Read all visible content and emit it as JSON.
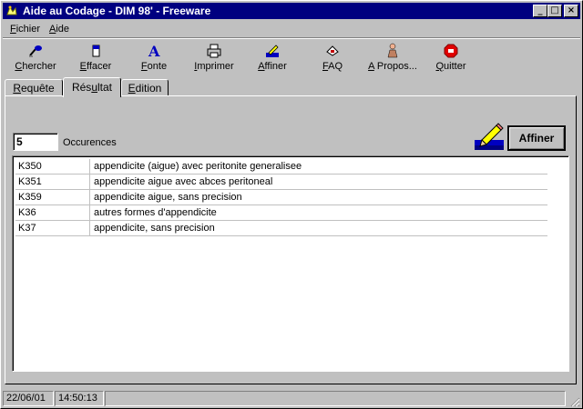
{
  "window": {
    "title": "Aide au Codage - DIM 98' - Freeware",
    "controls": {
      "minimize": "_",
      "maximize": "□",
      "close": "×"
    }
  },
  "menu": [
    {
      "mn": "F",
      "rest": "ichier"
    },
    {
      "mn": "A",
      "rest": "ide"
    }
  ],
  "toolbar": [
    {
      "id": "chercher",
      "icon": "search-icon",
      "mn": "C",
      "rest": "hercher"
    },
    {
      "id": "effacer",
      "icon": "eraser-icon",
      "mn": "E",
      "rest": "ffacer"
    },
    {
      "id": "fonte",
      "icon": "font-icon",
      "mn": "F",
      "rest": "onte"
    },
    {
      "id": "imprimer",
      "icon": "printer-icon",
      "mn": "I",
      "rest": "mprimer"
    },
    {
      "id": "affiner",
      "icon": "pencil-icon",
      "mn": "A",
      "rest": "ffiner"
    },
    {
      "id": "faq",
      "icon": "faq-icon",
      "mn": "F",
      "rest": "AQ"
    },
    {
      "id": "apropos",
      "icon": "person-icon",
      "mn": "A",
      "rest": " Propos..."
    },
    {
      "id": "quitter",
      "icon": "stop-icon",
      "mn": "Q",
      "rest": "uitter"
    }
  ],
  "tabs": [
    {
      "id": "requete",
      "pre": "",
      "mn": "R",
      "rest": "equête",
      "active": false
    },
    {
      "id": "resultat",
      "pre": "Rés",
      "mn": "u",
      "rest": "ltat",
      "active": true
    },
    {
      "id": "edition",
      "pre": "",
      "mn": "E",
      "rest": "dition",
      "active": false
    }
  ],
  "results": {
    "count": "5",
    "count_label": "Occurences",
    "affiner_button": "Affiner",
    "rows": [
      {
        "code": "K350",
        "label": "appendicite (aigue) avec peritonite generalisee"
      },
      {
        "code": "K351",
        "label": "appendicite aigue avec abces peritoneal"
      },
      {
        "code": "K359",
        "label": "appendicite aigue, sans precision"
      },
      {
        "code": "K36",
        "label": "autres formes d'appendicite"
      },
      {
        "code": "K37",
        "label": "appendicite, sans precision"
      }
    ]
  },
  "status": {
    "date": "22/06/01",
    "time": "14:50:13"
  }
}
